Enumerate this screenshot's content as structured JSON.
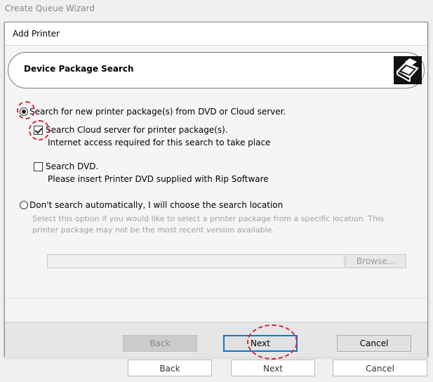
{
  "window": {
    "title": "Create Queue Wizard"
  },
  "background_buttons": {
    "back": "Back",
    "next": "Next",
    "cancel": "Cancel"
  },
  "dialog": {
    "title": "Add Printer",
    "header": {
      "title": "Device Package Search",
      "icon": "printer-icon"
    },
    "options": {
      "search_new": {
        "label": "Search for new printer package(s) from DVD or Cloud server.",
        "selected": true
      },
      "search_cloud": {
        "label": "Search Cloud server for printer package(s).",
        "note": "Internet access required for this search to take place",
        "checked": true
      },
      "search_dvd": {
        "label": "Search DVD.",
        "note": "Please insert Printer DVD supplied with Rip Software",
        "checked": false
      },
      "manual": {
        "label": "Don't search automatically, I will choose the search location",
        "selected": false,
        "hint": "Select this option if you would like to select a printer package from a specific location. This printer package may not be the most recent version available."
      }
    },
    "path_field": {
      "value": ""
    },
    "browse_button": "Browse...",
    "buttons": {
      "back": "Back",
      "next": "Next",
      "cancel": "Cancel"
    }
  },
  "annotation_color": "#d2283c"
}
